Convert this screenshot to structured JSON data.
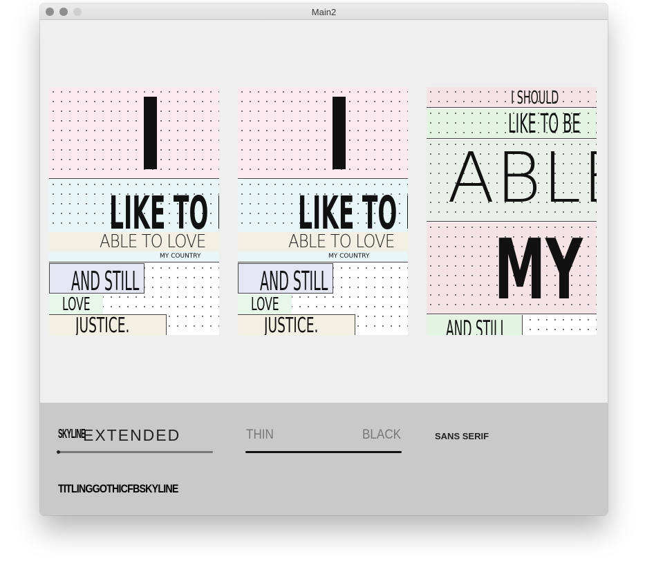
{
  "window": {
    "title": "Main2"
  },
  "posters": [
    {
      "big_letter": "I",
      "line2": "LIKE TO BE",
      "line3": "ABLE TO LOVE",
      "small": "MY COUNTRY",
      "line4": "AND STILL",
      "line5": "LOVE",
      "line6": "JUSTICE."
    },
    {
      "big_letter": "I",
      "line2": "LIKE TO BE",
      "line3": "ABLE TO LOVE",
      "small": "MY COUNTRY",
      "line4": "AND STILL",
      "line5": "LOVE",
      "line6": "JUSTICE."
    },
    {
      "line1": "I SHOULD",
      "line2": "LIKE TO BE",
      "line3": "ABLE",
      "line4": "MY",
      "line5": "AND STILL"
    }
  ],
  "controls": {
    "width_slider": {
      "left_label": "SKYLINE",
      "right_label": "EXTENDED",
      "value": 0.0
    },
    "weight_slider": {
      "left_label": "THIN",
      "right_label": "BLACK",
      "value": 1.0
    },
    "sans_serif_label": "SANS SERIF",
    "font_name": "TITLINGGOTHICFBSKYLINE"
  },
  "colors": {
    "pink": "#fbe9ef",
    "light_blue": "#e9f6f8",
    "beige": "#f1f0e2",
    "lavender": "#e5e6f3",
    "mint": "#e9f6ea",
    "rose": "#f6e3e6",
    "light_green": "#e4f4e3",
    "grey_green": "#e9efe9",
    "panel": "#c9c9c9"
  }
}
